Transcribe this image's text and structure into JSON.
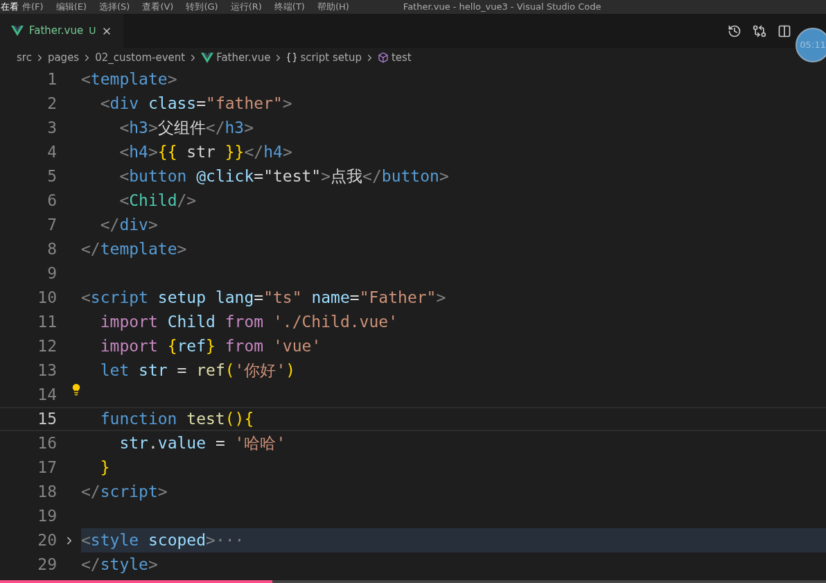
{
  "menu_bar": {
    "overlay_label": "在看",
    "items": [
      "件(F)",
      "编辑(E)",
      "选择(S)",
      "查看(V)",
      "转到(G)",
      "运行(R)",
      "终端(T)",
      "帮助(H)"
    ],
    "window_title": "Father.vue - hello_vue3 - Visual Studio Code"
  },
  "tabs": [
    {
      "label": "Father.vue",
      "badge": "U",
      "selected": true
    }
  ],
  "breadcrumb": [
    {
      "label": "src",
      "kind": "folder"
    },
    {
      "label": "pages",
      "kind": "folder"
    },
    {
      "label": "02_custom-event",
      "kind": "folder"
    },
    {
      "label": "Father.vue",
      "kind": "vue"
    },
    {
      "label": "script setup",
      "kind": "braces"
    },
    {
      "label": "test",
      "kind": "symbol"
    }
  ],
  "timer": "05:11",
  "editor": {
    "lines": [
      {
        "number": "1",
        "tokens": [
          {
            "kind": "punct",
            "text": "<"
          },
          {
            "kind": "tag",
            "text": "template"
          },
          {
            "kind": "punct",
            "text": ">"
          }
        ]
      },
      {
        "number": "2",
        "tokens": [
          {
            "kind": "punct",
            "text": "  <"
          },
          {
            "kind": "tag",
            "text": "div"
          },
          {
            "kind": "attr",
            "text": " class"
          },
          {
            "kind": "text",
            "text": "="
          },
          {
            "kind": "string",
            "text": "\"father\""
          },
          {
            "kind": "punct",
            "text": ">"
          }
        ]
      },
      {
        "number": "3",
        "tokens": [
          {
            "kind": "punct",
            "text": "    <"
          },
          {
            "kind": "tag",
            "text": "h3"
          },
          {
            "kind": "punct",
            "text": ">"
          },
          {
            "kind": "text",
            "text": "父组件"
          },
          {
            "kind": "punct",
            "text": "</"
          },
          {
            "kind": "tag",
            "text": "h3"
          },
          {
            "kind": "punct",
            "text": ">"
          }
        ]
      },
      {
        "number": "4",
        "tokens": [
          {
            "kind": "punct",
            "text": "    <"
          },
          {
            "kind": "tag",
            "text": "h4"
          },
          {
            "kind": "punct",
            "text": ">"
          },
          {
            "kind": "brace",
            "text": "{{"
          },
          {
            "kind": "text",
            "text": " str "
          },
          {
            "kind": "brace",
            "text": "}}"
          },
          {
            "kind": "punct",
            "text": "</"
          },
          {
            "kind": "tag",
            "text": "h4"
          },
          {
            "kind": "punct",
            "text": ">"
          }
        ]
      },
      {
        "number": "5",
        "tokens": [
          {
            "kind": "punct",
            "text": "    <"
          },
          {
            "kind": "tag",
            "text": "button"
          },
          {
            "kind": "attr",
            "text": " @click"
          },
          {
            "kind": "text",
            "text": "=\"test\""
          },
          {
            "kind": "punct",
            "text": ">"
          },
          {
            "kind": "text",
            "text": "点我"
          },
          {
            "kind": "punct",
            "text": "</"
          },
          {
            "kind": "tag",
            "text": "button"
          },
          {
            "kind": "punct",
            "text": ">"
          }
        ]
      },
      {
        "number": "6",
        "tokens": [
          {
            "kind": "punct",
            "text": "    <"
          },
          {
            "kind": "component",
            "text": "Child"
          },
          {
            "kind": "punct",
            "text": "/>"
          }
        ]
      },
      {
        "number": "7",
        "tokens": [
          {
            "kind": "punct",
            "text": "  </"
          },
          {
            "kind": "tag",
            "text": "div"
          },
          {
            "kind": "punct",
            "text": ">"
          }
        ]
      },
      {
        "number": "8",
        "tokens": [
          {
            "kind": "punct",
            "text": "</"
          },
          {
            "kind": "tag",
            "text": "template"
          },
          {
            "kind": "punct",
            "text": ">"
          }
        ]
      },
      {
        "number": "9"
      },
      {
        "number": "10",
        "tokens": [
          {
            "kind": "punct",
            "text": "<"
          },
          {
            "kind": "tag",
            "text": "script"
          },
          {
            "kind": "attr",
            "text": " setup lang"
          },
          {
            "kind": "text",
            "text": "="
          },
          {
            "kind": "string",
            "text": "\"ts\""
          },
          {
            "kind": "attr",
            "text": " name"
          },
          {
            "kind": "text",
            "text": "="
          },
          {
            "kind": "string",
            "text": "\"Father\""
          },
          {
            "kind": "punct",
            "text": ">"
          }
        ]
      },
      {
        "number": "11",
        "tokens": [
          {
            "kind": "keyword",
            "text": "  import"
          },
          {
            "kind": "var",
            "text": " Child"
          },
          {
            "kind": "keyword",
            "text": " from"
          },
          {
            "kind": "string",
            "text": " './Child.vue'"
          }
        ]
      },
      {
        "number": "12",
        "tokens": [
          {
            "kind": "keyword",
            "text": "  import"
          },
          {
            "kind": "brace",
            "text": " {"
          },
          {
            "kind": "var",
            "text": "ref"
          },
          {
            "kind": "brace",
            "text": "}"
          },
          {
            "kind": "keyword",
            "text": " from"
          },
          {
            "kind": "string",
            "text": " 'vue'"
          }
        ]
      },
      {
        "number": "13",
        "tokens": [
          {
            "kind": "storage",
            "text": "  let"
          },
          {
            "kind": "var",
            "text": " str"
          },
          {
            "kind": "text",
            "text": " = "
          },
          {
            "kind": "func",
            "text": "ref"
          },
          {
            "kind": "brace",
            "text": "("
          },
          {
            "kind": "string",
            "text": "'你好'"
          },
          {
            "kind": "brace",
            "text": ")"
          }
        ]
      },
      {
        "number": "14",
        "lightbulb": true
      },
      {
        "number": "15",
        "tokens": [
          {
            "kind": "storage",
            "text": "  function"
          },
          {
            "kind": "func",
            "text": " test"
          },
          {
            "kind": "brace",
            "text": "(){"
          }
        ],
        "selected": true
      },
      {
        "number": "16",
        "tokens": [
          {
            "kind": "var",
            "text": "    str"
          },
          {
            "kind": "text",
            "text": "."
          },
          {
            "kind": "var",
            "text": "value"
          },
          {
            "kind": "text",
            "text": " = "
          },
          {
            "kind": "string",
            "text": "'哈哈'"
          }
        ]
      },
      {
        "number": "17",
        "tokens": [
          {
            "kind": "brace",
            "text": "  }"
          }
        ]
      },
      {
        "number": "18",
        "tokens": [
          {
            "kind": "punct",
            "text": "</"
          },
          {
            "kind": "tag",
            "text": "script"
          },
          {
            "kind": "punct",
            "text": ">"
          }
        ]
      },
      {
        "number": "19"
      },
      {
        "number": "20",
        "tokens": [
          {
            "kind": "punct",
            "text": "<"
          },
          {
            "kind": "tag",
            "text": "style"
          },
          {
            "kind": "attr",
            "text": " scoped"
          },
          {
            "kind": "punct",
            "text": ">"
          },
          {
            "kind": "punct",
            "text": "···"
          }
        ],
        "folded": true
      },
      {
        "number": "29",
        "tokens": [
          {
            "kind": "punct",
            "text": "</"
          },
          {
            "kind": "tag",
            "text": "style"
          },
          {
            "kind": "punct",
            "text": ">"
          }
        ]
      }
    ]
  },
  "video_progress": {
    "level": 0.33
  }
}
